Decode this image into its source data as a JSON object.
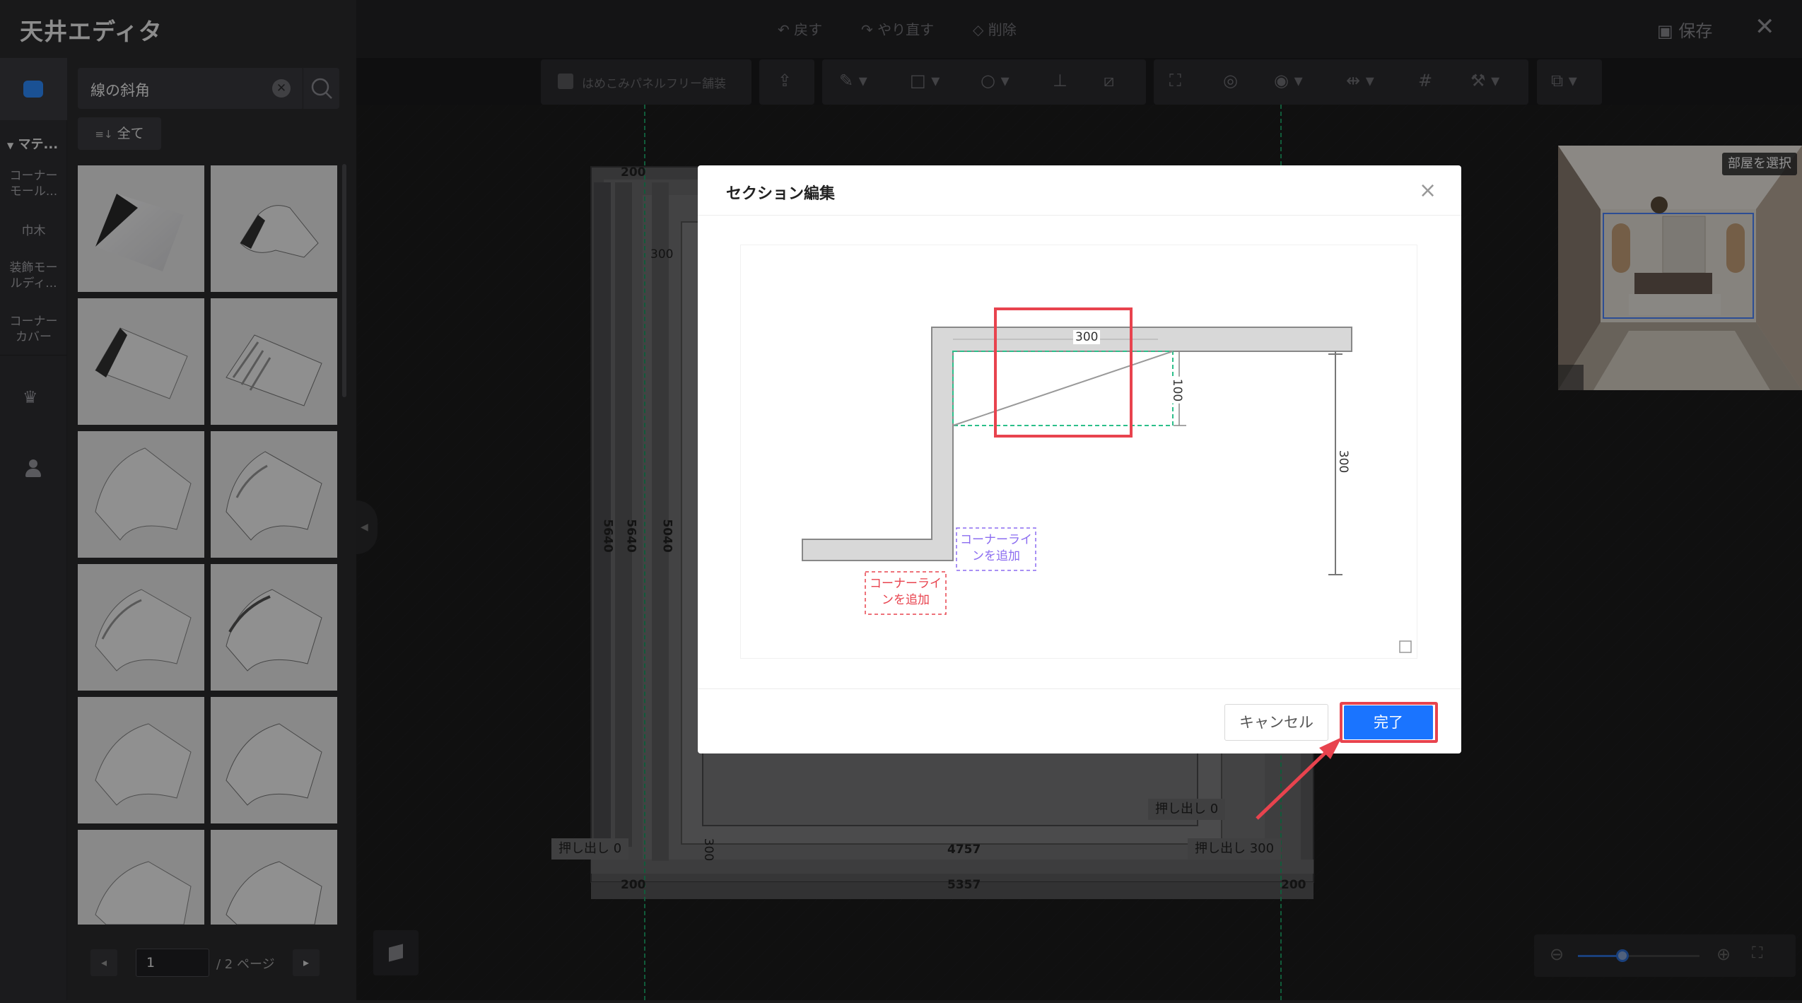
{
  "app": {
    "title": "天井エディタ"
  },
  "topbar": {
    "undo": "戻す",
    "redo": "やり直す",
    "delete": "削除",
    "save": "保存"
  },
  "sidebar": {
    "search_value": "線の斜角",
    "filter_label": "全て",
    "section_label": "マテ...",
    "categories": [
      {
        "label": "コーナー\nモール..."
      },
      {
        "label": "巾木"
      },
      {
        "label": "装飾モー\nルディ..."
      },
      {
        "label": "コーナー\nカバー"
      }
    ],
    "pagination": {
      "current": "1",
      "total": "/ 2 ページ"
    }
  },
  "toolbar": {
    "panel_free": "はめこみパネルフリー舗装"
  },
  "canvas": {
    "dims": {
      "top_left": "200",
      "left_300": "300",
      "height_a": "5640",
      "height_b": "5640",
      "height_c": "5040",
      "inner_width": "4757",
      "outer_width": "5357",
      "bottom_left": "200",
      "bottom_right": "200",
      "bottom_300": "300",
      "extrude_right_top": "押し出し 0",
      "extrude_left": "押し出し 0",
      "extrude_right": "押し出し 300"
    }
  },
  "preview": {
    "badge": "部屋を選択"
  },
  "modal": {
    "title": "セクション編集",
    "cancel": "キャンセル",
    "done": "完了",
    "section": {
      "dim_top": "300",
      "dim_side": "100",
      "dim_height": "300",
      "add_corner_purple": "コーナーライ\nンを追加",
      "add_corner_red": "コーナーライ\nンを追加"
    }
  },
  "colors": {
    "accent": "#1a74ff",
    "highlight": "#e8434e",
    "guide": "#1e9e64",
    "purple": "#8b6cf0"
  }
}
